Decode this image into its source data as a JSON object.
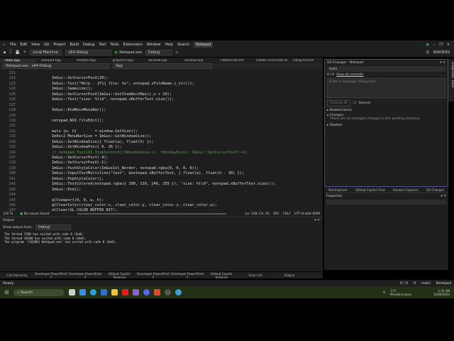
{
  "menu": [
    "File",
    "Edit",
    "View",
    "Git",
    "Project",
    "Build",
    "Debug",
    "Test",
    "Tools",
    "Extensions",
    "Window",
    "Help",
    "Search"
  ],
  "project_title": "Notepad",
  "toolbar": {
    "target": "Local Machine",
    "config": "x64-Debug",
    "startup": "Notepad.exe",
    "mode": "Debug",
    "insiders": "INSIDERS"
  },
  "tabs": [
    "main.cpp",
    "notepad.hpp",
    "filedata.hpp",
    "graphics.hpp",
    "window.cpp",
    "window.hpp",
    "CMakeLists.txt",
    "CMake Overview Pages",
    ".clang-format"
  ],
  "navbar": {
    "scope": "Notepad.exe - x64-Debug",
    "symbol": "App"
  },
  "code": [
    {
      "n": "121",
      "t": ""
    },
    {
      "n": "122",
      "t": "ImGui::SetCursorPosX(20);"
    },
    {
      "n": "123",
      "t": "ImGui::Text(\"Help - [F1] file: %s\", notepad.sFileName.c_str());"
    },
    {
      "n": "124",
      "t": "ImGui::SameLine();"
    },
    {
      "n": "125",
      "t": "ImGui::SetCursorPosX(ImGui::GetItemRectMax().x + 20);"
    },
    {
      "n": "126",
      "t": "ImGui::Text(\"size: %lld\", notepad.sBufferText.size());"
    },
    {
      "n": "127",
      "t": ""
    },
    {
      "n": "128",
      "t": "ImGui::EndMainMenuBar();"
    },
    {
      "n": "129",
      "t": ""
    },
    {
      "n": "130",
      "t": "notepad.NUI.fileEdit();"
    },
    {
      "n": "131",
      "t": ""
    },
    {
      "n": "132",
      "t": "auto [w, h]        = window.GetSize();"
    },
    {
      "n": "133",
      "t": "ImVec2 MenuBarSize = ImGui::GetWindowSize();"
    },
    {
      "n": "134",
      "t": "ImGui::SetWindowSize({ float(w), float(h) });"
    },
    {
      "n": "135",
      "t": "ImGui::SetWindowPos({ 0, 26 });"
    },
    {
      "n": "136",
      "t": "// notepad.ToolsUI.ItemCenterX((fWindowSize.x), fWindowSize); ImGui::SetCursorPosY(-4);",
      "c": true
    },
    {
      "n": "137",
      "t": "ImGui::SetCursorPosY(-4);"
    },
    {
      "n": "138",
      "t": "ImGui::SetCursorPosX(-1);"
    },
    {
      "n": "139",
      "t": "ImGui::PushStyleColor(ImGuiCol_Border, notepad.rgba(0, 0, 0, 0));"
    },
    {
      "n": "140",
      "t": "ImGui::InputTextMultiline(\"text\", &notepad.sBufferText, { float(w), float(h - 30) });"
    },
    {
      "n": "141",
      "t": "ImGui::PopStyleColor();"
    },
    {
      "n": "142",
      "t": "ImGui::TextColored(notepad.rgba({ 100, 110, 246, 255 }), \"size: %lld\", notepad.sBufferText.size());"
    },
    {
      "n": "143",
      "t": "ImGui::End();"
    },
    {
      "n": "144",
      "t": ""
    },
    {
      "n": "145",
      "t": "glViewport(0, 0, w, h);"
    },
    {
      "n": "146",
      "t": "glClearColor(clear_color.x, clear_color.y, clear_color.z, clear_color.w);"
    },
    {
      "n": "147",
      "t": "glClear(GL_COLOR_BUFFER_BIT);"
    }
  ],
  "editor_status": {
    "zoom": "130 %",
    "issues": "No issues found",
    "position": "Ln: 158, Ch: 45",
    "spc": "SPC",
    "eol": "CRLF",
    "encoding": "UTF-8 with BOM"
  },
  "output": {
    "title": "Output",
    "show_from_label": "Show output from:",
    "source": "Debug",
    "lines": [
      "The thread 1708 has exited with code 0 (0x0).",
      "The thread 10180 has exited with code 0 (0x0).",
      "The program '[10200] Notepad.exe' has exited with code 0 (0x0)."
    ]
  },
  "bottom_tabs": [
    "Call Hierarchy",
    "Developer PowerShell 7",
    "Developer PowerShell 7",
    "GitHub Copilot Terminal",
    "Developer PowerShell 7",
    "Developer PowerShell 7",
    "GitHub Copilot Terminal",
    "Error List",
    "Output"
  ],
  "git": {
    "title": "Git Changes - Notepad",
    "branch": "main",
    "commits": "0 / 0",
    "view_all": "View all commits",
    "message_placeholder": "Enter a message <Required>",
    "commit_all": "Commit All",
    "amend": "Amend",
    "related": "Related Items",
    "changes": "Changes",
    "no_changes": "There are no unstaged changes in the working directory.",
    "stashes": "Stashes"
  },
  "right_tabs": [
    "Test Explorer",
    "GitHub Copilot Chat",
    "Solution Explorer",
    "Git Changes"
  ],
  "properties_title": "Properties",
  "diagnostic": "Diagnostic Tools",
  "statusbar": {
    "ready": "Ready",
    "sync": "0 / 0",
    "edits": "0",
    "branch": "main",
    "repo": "Notepad"
  },
  "taskbar": {
    "search": "Search",
    "weather_temp": "-1°C",
    "weather_desc": "Převážně jasno",
    "time": "1:31 AM",
    "date": "12/06/2024"
  }
}
